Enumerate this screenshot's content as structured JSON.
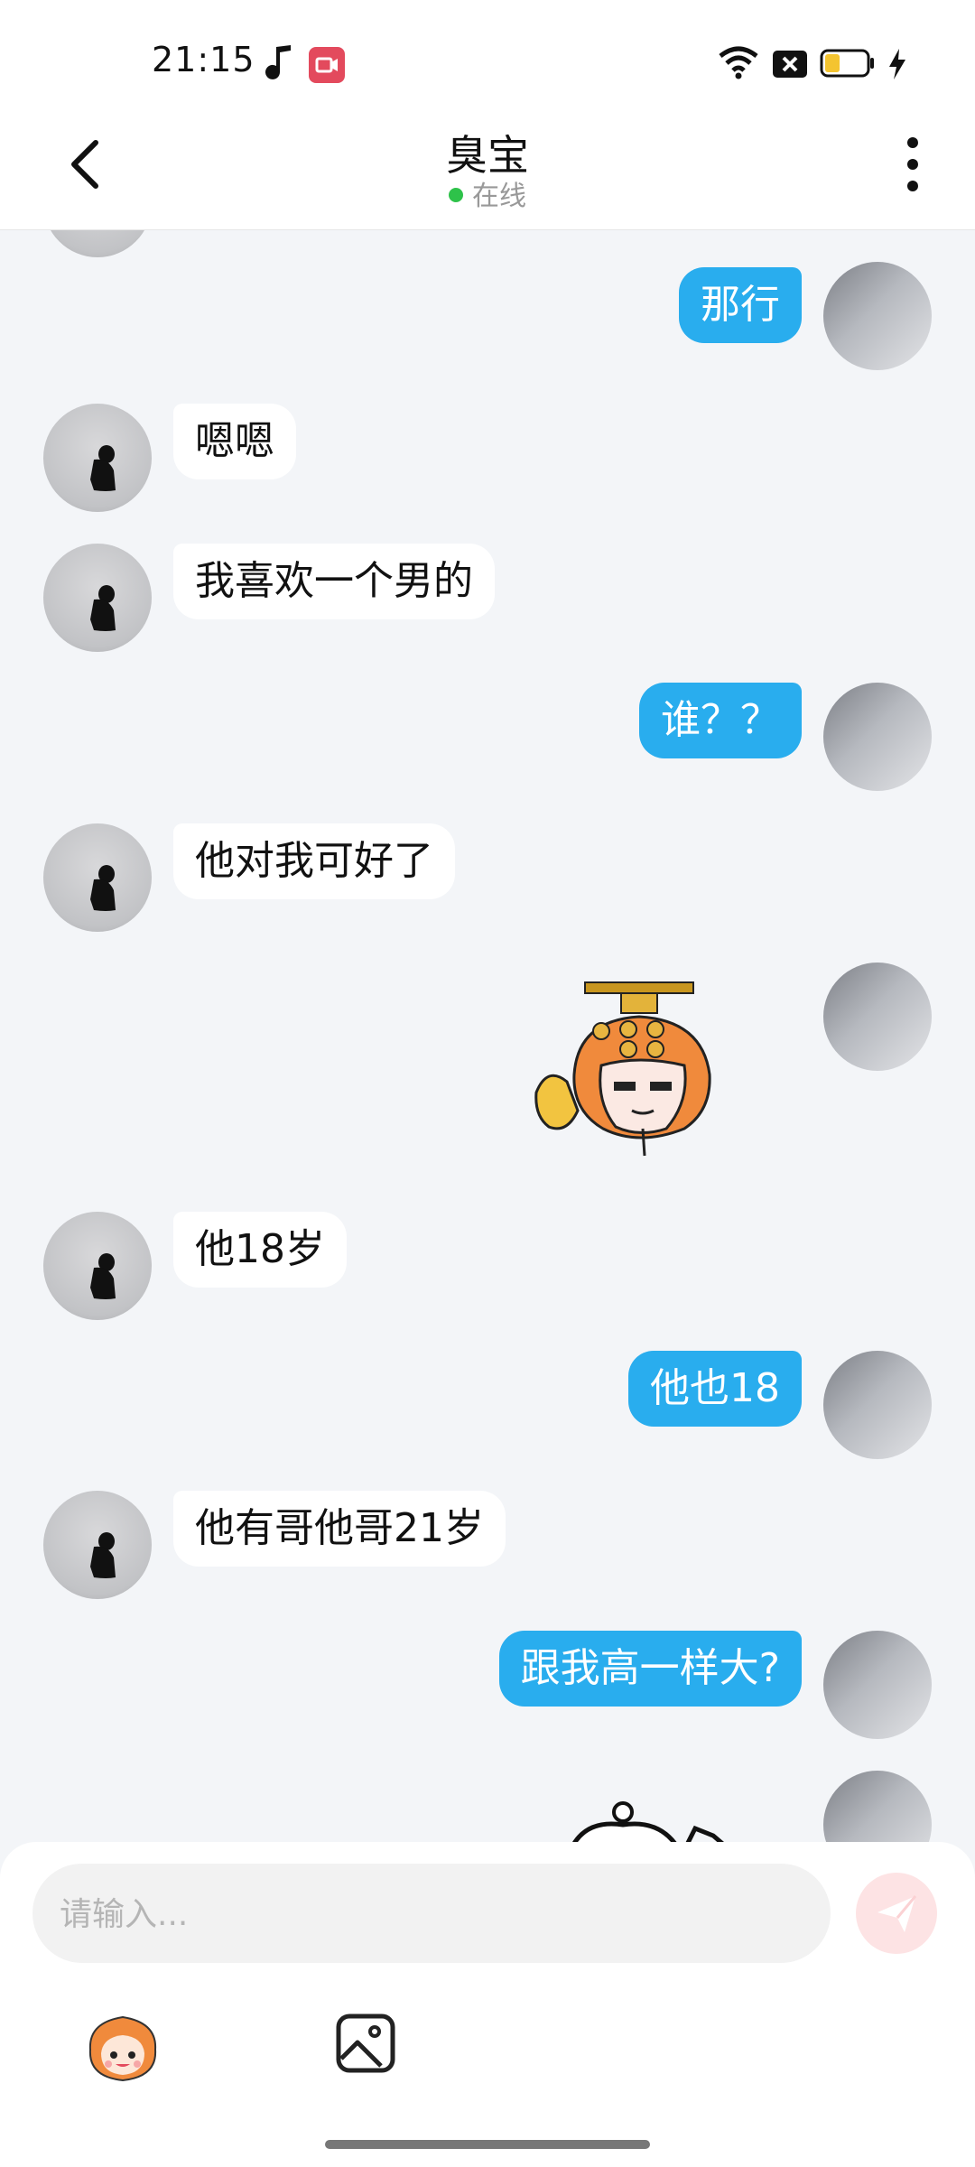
{
  "status_bar": {
    "time": "21:15"
  },
  "header": {
    "contact_name": "臭宝",
    "status_text": "在线"
  },
  "messages": [
    {
      "side": "out",
      "type": "text",
      "text": "那行"
    },
    {
      "side": "in",
      "type": "text",
      "text": "嗯嗯"
    },
    {
      "side": "in",
      "type": "text",
      "text": "我喜欢一个男的"
    },
    {
      "side": "out",
      "type": "text",
      "text": "谁？？"
    },
    {
      "side": "in",
      "type": "text",
      "text": "他对我可好了"
    },
    {
      "side": "out",
      "type": "sticker",
      "sticker": "monkey-king-sticker"
    },
    {
      "side": "in",
      "type": "text",
      "text": "他18岁"
    },
    {
      "side": "out",
      "type": "text",
      "text": "他也18"
    },
    {
      "side": "in",
      "type": "text",
      "text": "他有哥他哥21岁"
    },
    {
      "side": "out",
      "type": "text",
      "text": "跟我高一样大?"
    },
    {
      "side": "out",
      "type": "sticker",
      "sticker": "cartoon-sticker-partial"
    }
  ],
  "composer": {
    "placeholder": "请输入..."
  },
  "colors": {
    "outgoing_bubble": "#29adee",
    "incoming_bubble": "#ffffff",
    "online_dot": "#2ec24a",
    "send_button": "#fde3e4"
  }
}
